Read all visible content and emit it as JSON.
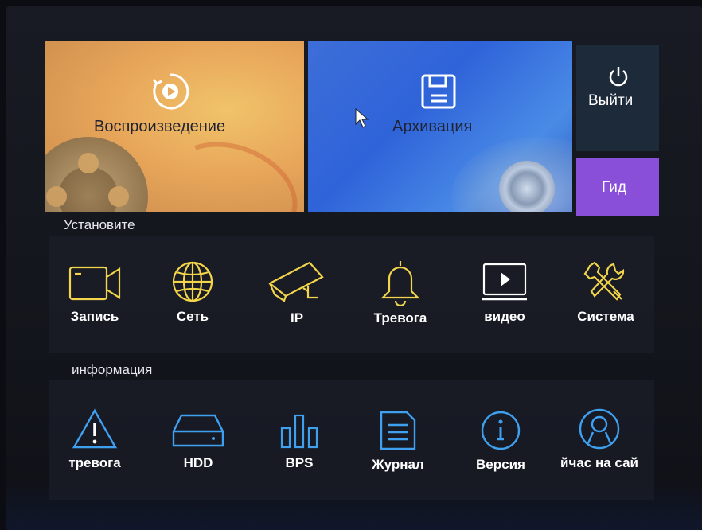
{
  "tiles": {
    "playback": {
      "label": "Воспроизведение",
      "icon": "play-circle-icon"
    },
    "backup": {
      "label": "Архивация",
      "icon": "floppy-disk-icon"
    },
    "exit": {
      "label": "Выйти",
      "icon": "power-icon"
    },
    "guide": {
      "label": "Гид"
    }
  },
  "setup": {
    "title": "Установите",
    "items": [
      {
        "label": "Запись",
        "icon": "camera-icon"
      },
      {
        "label": "Сеть",
        "icon": "globe-icon"
      },
      {
        "label": "IP",
        "icon": "cctv-camera-icon"
      },
      {
        "label": "Тревога",
        "icon": "bell-icon"
      },
      {
        "label": "видео",
        "icon": "monitor-play-icon"
      },
      {
        "label": "Система",
        "icon": "tools-icon"
      }
    ]
  },
  "info": {
    "title": "информация",
    "items": [
      {
        "label": "тревога",
        "icon": "warning-icon"
      },
      {
        "label": "HDD",
        "icon": "hard-drive-icon"
      },
      {
        "label": "BPS",
        "icon": "bar-chart-icon"
      },
      {
        "label": "Журнал",
        "icon": "document-icon"
      },
      {
        "label": "Версия",
        "icon": "info-icon"
      },
      {
        "label": "йчас на сай",
        "icon": "user-icon"
      }
    ]
  },
  "colors": {
    "setup_icon": "#f2d54a",
    "info_icon": "#3fa0f0",
    "guide_tile": "#8a4fd8",
    "backup_tile": "#2f63d9",
    "playback_tile": "#e8a65a"
  }
}
